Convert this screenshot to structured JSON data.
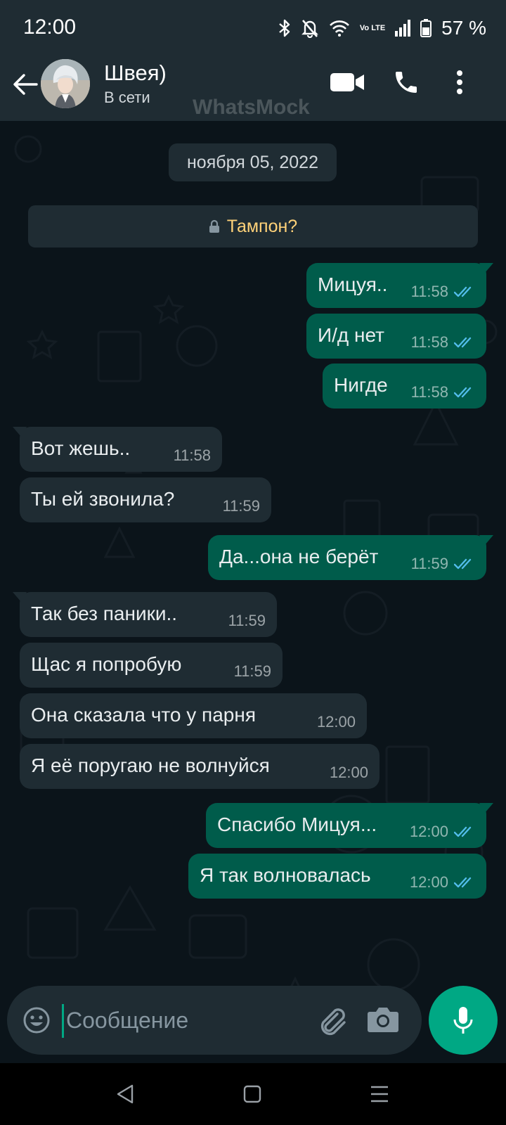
{
  "status_bar": {
    "time": "12:00",
    "network_label": "Vo LTE",
    "battery": "57 %"
  },
  "header": {
    "name": "Швея)",
    "status": "В сети",
    "watermark": "WhatsMock"
  },
  "chat": {
    "date_chip": "ноября 05, 2022",
    "encryption_notice": "Тампон?",
    "messages": [
      {
        "direction": "out",
        "text": "Мицуя..",
        "time": "11:58",
        "read": true
      },
      {
        "direction": "out",
        "text": "И/д нет",
        "time": "11:58",
        "read": true
      },
      {
        "direction": "out",
        "text": "Нигде",
        "time": "11:58",
        "read": true
      },
      {
        "direction": "in",
        "text": "Вот жешь..",
        "time": "11:58"
      },
      {
        "direction": "in",
        "text": "Ты ей звонила?",
        "time": "11:59"
      },
      {
        "direction": "out",
        "text": "Да...она не берёт",
        "time": "11:59",
        "read": true
      },
      {
        "direction": "in",
        "text": "Так без паники..",
        "time": "11:59"
      },
      {
        "direction": "in",
        "text": "Щас я попробую",
        "time": "11:59"
      },
      {
        "direction": "in",
        "text": "Она сказала что у парня",
        "time": "12:00"
      },
      {
        "direction": "in",
        "text": "Я её поругаю не волнуйся",
        "time": "12:00"
      },
      {
        "direction": "out",
        "text": "Спасибо Мицуя...",
        "time": "12:00",
        "read": true
      },
      {
        "direction": "out",
        "text": "Я так волновалась",
        "time": "12:00",
        "read": true
      }
    ]
  },
  "input": {
    "placeholder": "Сообщение",
    "value": ""
  },
  "colors": {
    "header_bg": "#1f2c33",
    "chat_bg": "#0b141a",
    "outgoing_bubble": "#005c4b",
    "incoming_bubble": "#1f2c33",
    "accent": "#00a884",
    "read_ticks": "#53bdeb",
    "notice_text": "#ffd279"
  },
  "icons": {
    "header": [
      "back-arrow-icon",
      "video-call-icon",
      "voice-call-icon",
      "more-options-icon"
    ],
    "input": [
      "emoji-icon",
      "attach-icon",
      "camera-icon",
      "mic-icon"
    ],
    "nav": [
      "nav-back-icon",
      "nav-home-icon",
      "nav-recents-icon"
    ]
  }
}
